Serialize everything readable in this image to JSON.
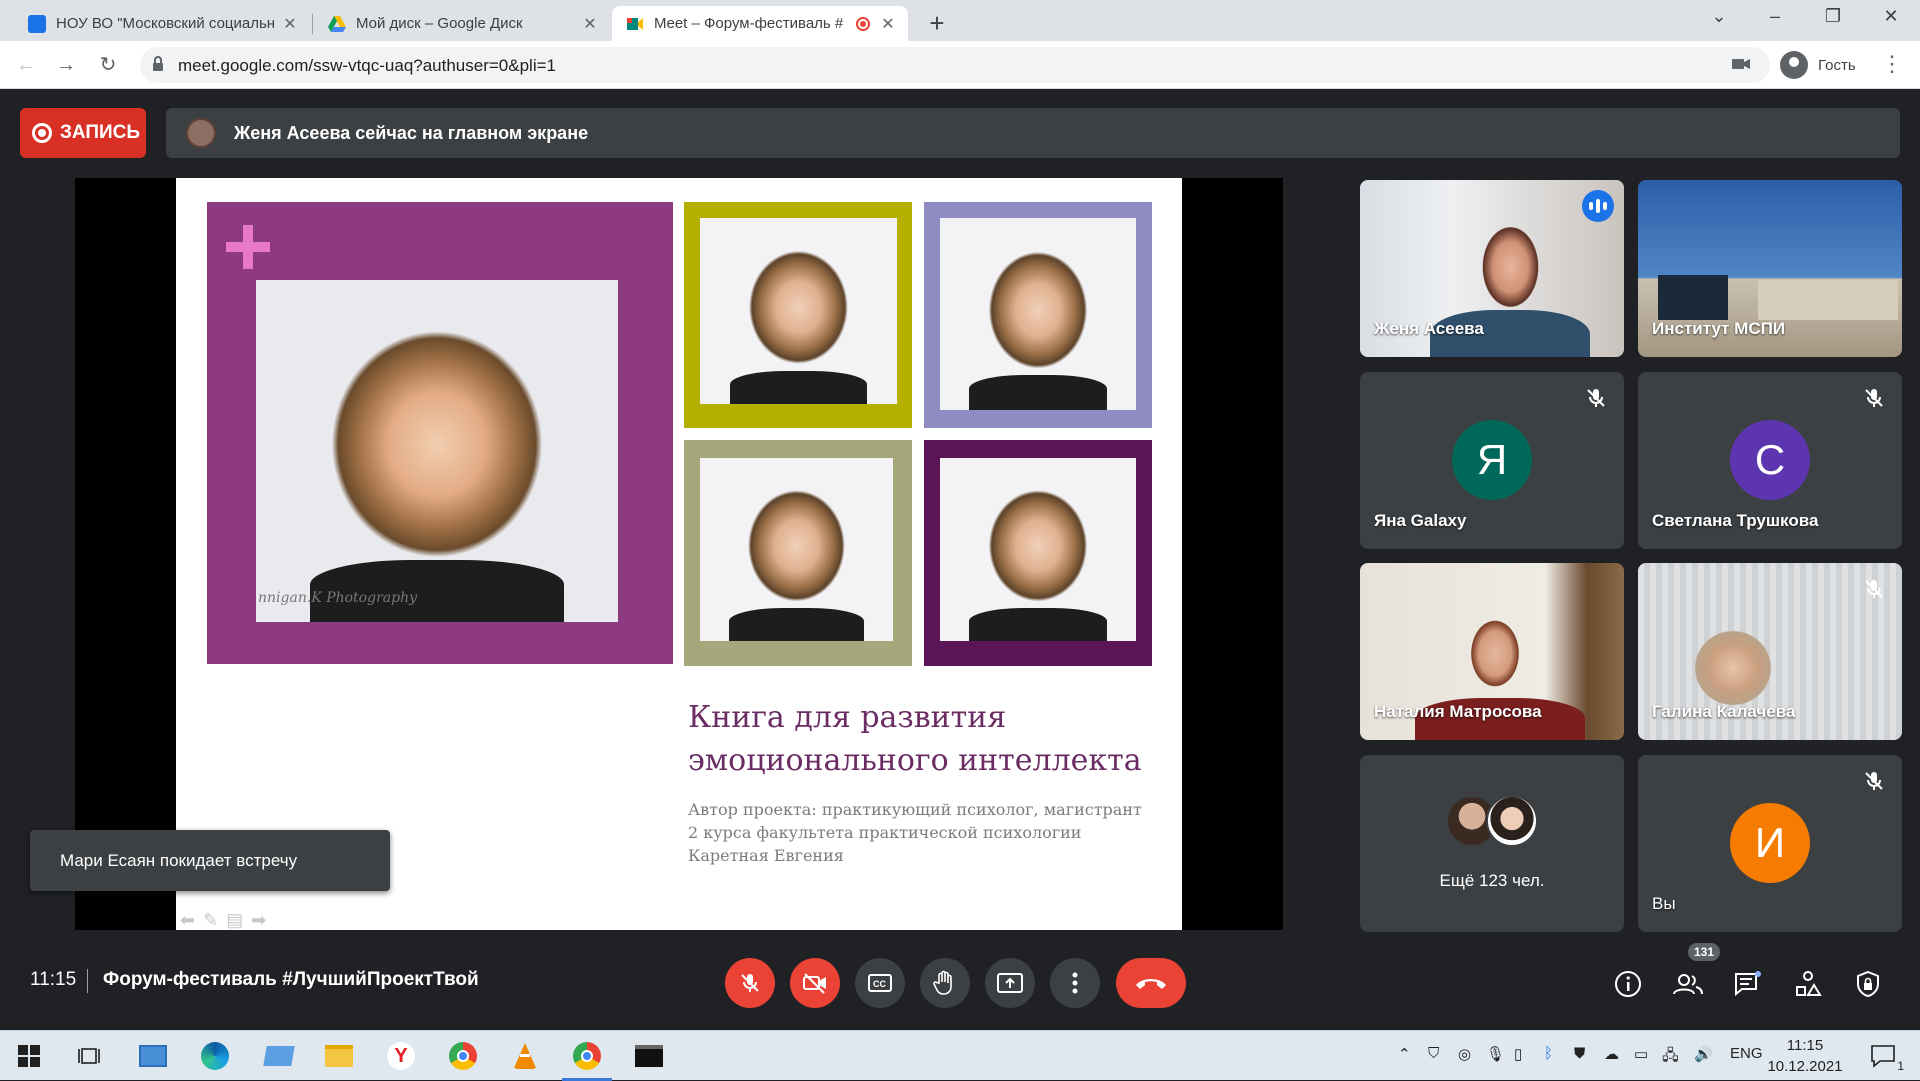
{
  "browser": {
    "tabs": [
      {
        "title": "НОУ ВО \"Московский социальн",
        "favicon_color": "#1a73e8"
      },
      {
        "title": "Мой диск – Google Диск",
        "favicon_color": "#fbbc04"
      },
      {
        "title": "Meet – Форум-фестиваль #",
        "favicon_color": "#00897b"
      }
    ],
    "url": "meet.google.com/ssw-vtqc-uaq?authuser=0&pli=1",
    "profile_label": "Гость"
  },
  "meet": {
    "record_label": "ЗАПИСЬ",
    "banner_text": "Женя Асеева сейчас на главном экране",
    "toast_text": "Мари Есаян покидает встречу",
    "clock": "11:15",
    "meeting_title": "Форум-фестиваль #ЛучшийПроектТвой",
    "participants_count": "131"
  },
  "slide": {
    "title_line1": "Книга для развития",
    "title_line2": "эмоционального интеллекта",
    "subtitle_line1": "Автор проекта: практикующий психолог, магистрант",
    "subtitle_line2": "2 курса факультета практической психологии",
    "subtitle_line3": "Каретная Евгения",
    "watermark": "nnigan.K Photography",
    "colors": {
      "magenta": "#8e3a82",
      "olive": "#b5b000",
      "lavender": "#8f8cc4",
      "sage": "#a6a77a",
      "plum": "#5a1559"
    }
  },
  "tiles": [
    {
      "name": "Женя Асеева",
      "type": "video"
    },
    {
      "name": "Институт МСПИ",
      "type": "video"
    },
    {
      "name": "Яна Galaxy",
      "letter": "Я",
      "color": "#00695c"
    },
    {
      "name": "Светлана Трушкова",
      "letter": "С",
      "color": "#5e35b1"
    },
    {
      "name": "Наталия Матросова",
      "type": "video"
    },
    {
      "name": "Галина Калачева",
      "type": "video"
    },
    {
      "name": "Ещё 123 чел.",
      "type": "more"
    },
    {
      "name": "Вы",
      "letter": "И",
      "color": "#f57c00"
    }
  ],
  "taskbar": {
    "lang": "ENG",
    "time": "11:15",
    "date": "10.12.2021",
    "notif_count": "1"
  }
}
